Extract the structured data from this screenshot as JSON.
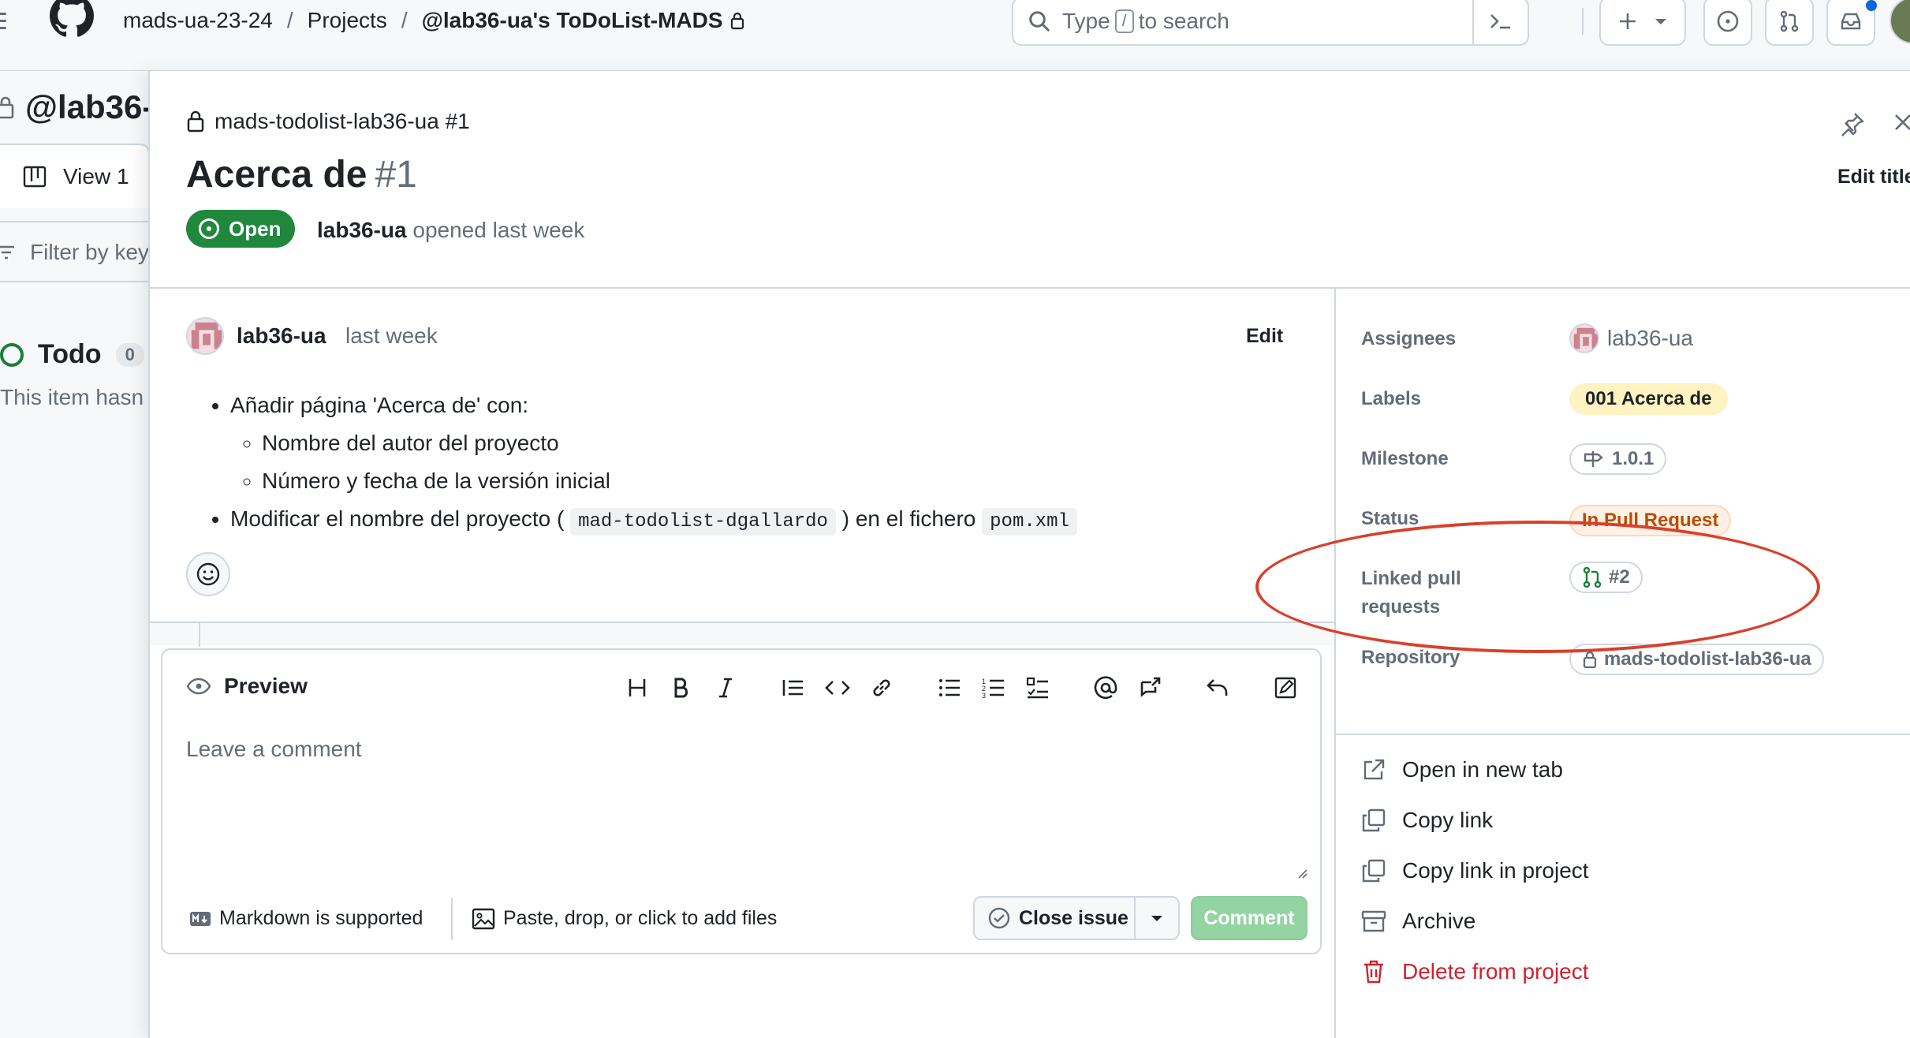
{
  "header": {
    "org": "mads-ua-23-24",
    "projects": "Projects",
    "project": "@lab36-ua's ToDoList-MADS",
    "search_prefix": "Type",
    "search_key": "/",
    "search_suffix": "to search"
  },
  "board": {
    "title": "@lab36-",
    "view_tab": "View 1",
    "filter_placeholder": "Filter by key",
    "column_name": "Todo",
    "column_count": "0",
    "column_empty": "This item hasn"
  },
  "issue": {
    "repo_ref": "mads-todolist-lab36-ua #1",
    "title": "Acerca de",
    "number": "#1",
    "state": "Open",
    "author": "lab36-ua",
    "opened_text": "opened last week",
    "edit_title": "Edit title"
  },
  "comment": {
    "author": "lab36-ua",
    "time": "last week",
    "edit": "Edit",
    "item1": "Añadir página 'Acerca de' con:",
    "sub1": "Nombre del autor del proyecto",
    "sub2": "Número y fecha de la versión inicial",
    "item2_a": "Modificar el nombre del proyecto (",
    "item2_code1": "mad-todolist-dgallardo",
    "item2_b": ") en el fichero",
    "item2_code2": "pom.xml"
  },
  "composer": {
    "tab": "Preview",
    "placeholder": "Leave a comment",
    "markdown_note": "Markdown is supported",
    "attach_note": "Paste, drop, or click to add files",
    "close_issue": "Close issue",
    "comment": "Comment"
  },
  "fields": {
    "assignees_label": "Assignees",
    "assignee": "lab36-ua",
    "labels_label": "Labels",
    "label": "001 Acerca de",
    "milestone_label": "Milestone",
    "milestone": "1.0.1",
    "status_label": "Status",
    "status": "In Pull Request",
    "linked_label_1": "Linked pull",
    "linked_label_2": "requests",
    "linked_pr": "#2",
    "repository_label": "Repository",
    "repository": "mads-todolist-lab36-ua"
  },
  "actions": {
    "open_new_tab": "Open in new tab",
    "copy_link": "Copy link",
    "copy_link_project": "Copy link in project",
    "archive": "Archive",
    "delete": "Delete from project"
  },
  "colors": {
    "open_green": "#1f883d",
    "status_orange": "#bc4c00",
    "label_yellow": "#fff3c2",
    "danger_red": "#cf222e",
    "annotation_red": "#d9402a",
    "comment_disabled": "#94d3a2"
  }
}
